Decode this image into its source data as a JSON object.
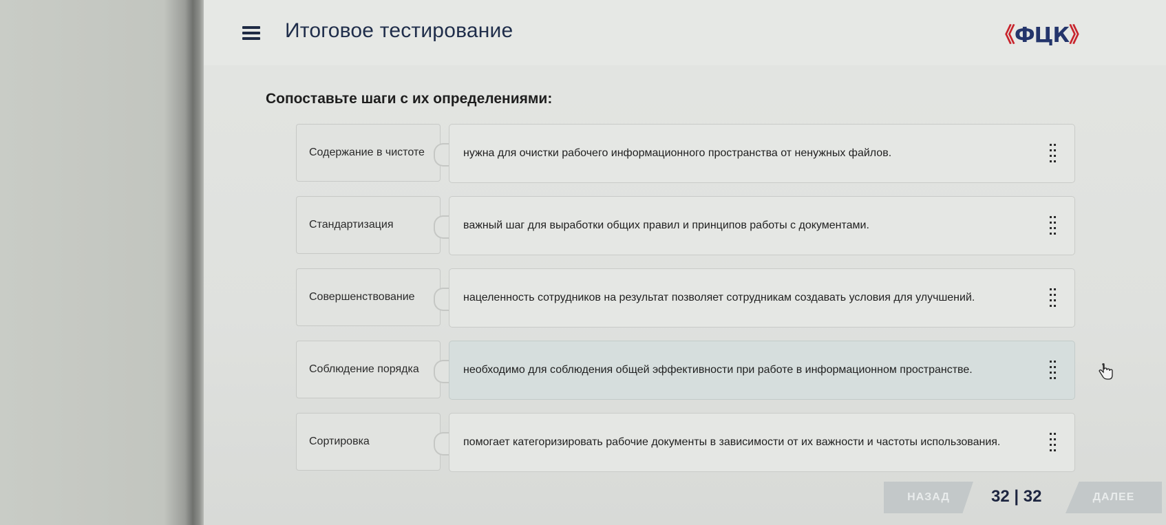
{
  "header": {
    "title": "Итоговое тестирование",
    "logo": {
      "left": "《",
      "text": "ФЦК",
      "right": "》",
      "icon": "brand-logo"
    },
    "menu_icon": "hamburger-menu-icon"
  },
  "question": "Сопоставьте шаги с их определениями:",
  "pairs": [
    {
      "term": "Содержание в чистоте",
      "definition": "нужна для очистки рабочего информационного пространства от ненужных файлов."
    },
    {
      "term": "Стандартизация",
      "definition": "важный шаг для выработки общих правил и принципов работы с документами."
    },
    {
      "term": "Совершенствование",
      "definition": "нацеленность сотрудников на результат позволяет сотрудникам создавать условия для улучшений."
    },
    {
      "term": "Соблюдение порядка",
      "definition": "необходимо для соблюдения общей эффективности при работе в информационном пространстве."
    },
    {
      "term": "Сортировка",
      "definition": "помогает категоризировать рабочие документы в зависимости от их важности и частоты использования."
    }
  ],
  "navigation": {
    "back_label": "НАЗАД",
    "next_label": "ДАЛЕЕ",
    "current": "32",
    "separator": "|",
    "total": "32"
  },
  "colors": {
    "title": "#1f2d4a",
    "logo_blue": "#24356b",
    "logo_red": "#c8242c",
    "nav_button": "#c3c8c9"
  }
}
